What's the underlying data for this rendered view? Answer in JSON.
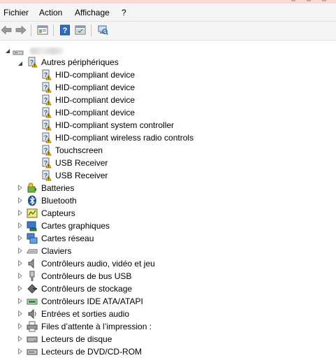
{
  "menu": {
    "fichier": "Fichier",
    "action": "Action",
    "affichage": "Affichage",
    "help": "?"
  },
  "tree": {
    "group_autres": "Autres périphériques",
    "autres_children": [
      "HID-compliant device",
      "HID-compliant device",
      "HID-compliant device",
      "HID-compliant device",
      "HID-compliant system controller",
      "HID-compliant wireless radio controls",
      "Touchscreen",
      "USB Receiver",
      "USB Receiver"
    ],
    "categories": [
      "Batteries",
      "Bluetooth",
      "Capteurs",
      "Cartes graphiques",
      "Cartes réseau",
      "Claviers",
      "Contrôleurs audio, vidéo et jeu",
      "Contrôleurs de bus USB",
      "Contrôleurs de stockage",
      "Contrôleurs IDE ATA/ATAPI",
      "Entrées et sorties audio",
      "Files d’attente à l’impression :",
      "Lecteurs de disque",
      "Lecteurs de DVD/CD-ROM"
    ]
  },
  "colors": {
    "accent_blue": "#2d6ec0",
    "warning_yellow": "#f2c200",
    "menubar_bg": "#f5f5f5"
  }
}
